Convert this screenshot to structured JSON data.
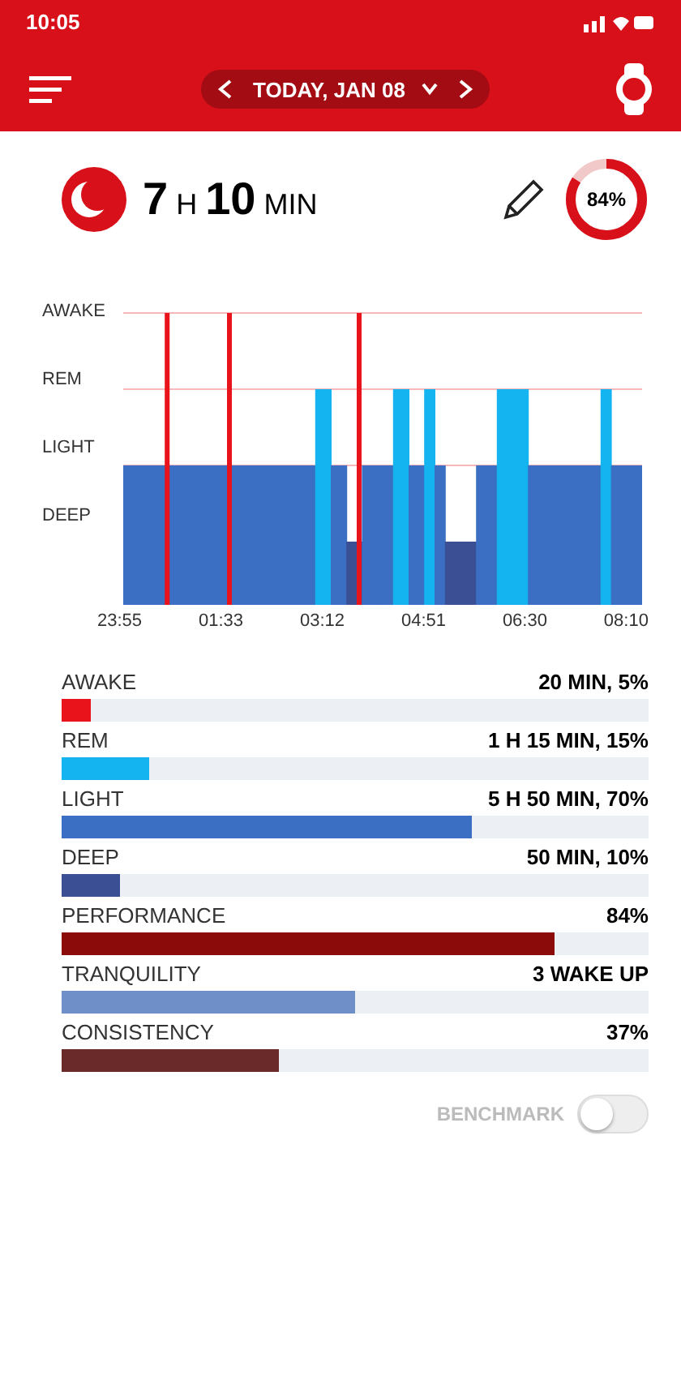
{
  "status_bar": {
    "time": "10:05"
  },
  "header": {
    "date": "TODAY, JAN 08"
  },
  "summary": {
    "duration_hours": "7",
    "hours_unit": "H",
    "duration_minutes": "10",
    "minutes_unit": "MIN",
    "score": "84%",
    "level": 0.84
  },
  "hypnogram": {
    "y_labels": [
      "AWAKE",
      "REM",
      "LIGHT",
      "DEEP"
    ],
    "x_labels": [
      "23:55",
      "01:33",
      "03:12",
      "04:51",
      "06:30",
      "08:10"
    ]
  },
  "stats": [
    {
      "label": "AWAKE",
      "value": "20 MIN, 5%",
      "level": 0.05,
      "color": "#e8131b"
    },
    {
      "label": "REM",
      "value": "1 H 15 MIN, 15%",
      "level": 0.15,
      "color": "#14b4f0"
    },
    {
      "label": "LIGHT",
      "value": "5 H 50 MIN, 70%",
      "level": 0.7,
      "color": "#3a6fc4"
    },
    {
      "label": "DEEP",
      "value": "50 MIN, 10%",
      "level": 0.1,
      "color": "#3b4f94"
    },
    {
      "label": "PERFORMANCE",
      "value": "84%",
      "level": 0.84,
      "color": "#8b0a0a"
    },
    {
      "label": "TRANQUILITY",
      "value": "3 WAKE UP",
      "level": 0.5,
      "color": "#6f8fc8"
    },
    {
      "label": "CONSISTENCY",
      "value": "37%",
      "level": 0.37,
      "color": "#6b2a2a"
    }
  ],
  "benchmark": {
    "label": "BENCHMARK",
    "on": false
  }
}
